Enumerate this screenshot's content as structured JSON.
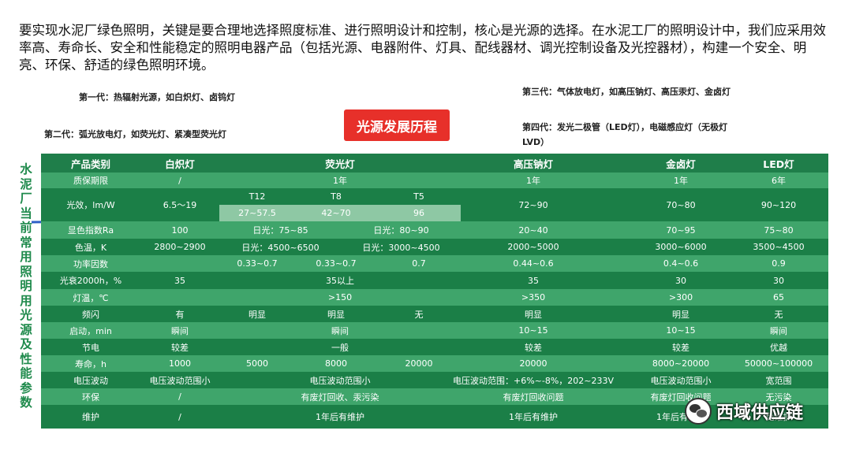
{
  "intro": "要实现水泥厂绿色照明，关键是要合理地选择照度标准、进行照明设计和控制，核心是光源的选择。在水泥工厂的照明设计中，我们应采用效率高、寿命长、安全和性能稳定的照明电器产品（包括光源、电器附件、灯具、配线器材、调光控制设备及光控器材），构建一个安全、明亮、环保、舒适的绿色照明环境。",
  "mindmap": {
    "center": "光源发展历程",
    "gen1": "第一代：热辐射光源，如白炽灯、卤钨灯",
    "gen2": "第二代：弧光放电灯，如荧光灯、紧凑型荧光灯",
    "gen3": "第三代：气体放电灯，如高压钠灯、高压汞灯、金卤灯",
    "gen4_line1": "第四代：发光二极管（LED灯），电磁感应灯（无极灯",
    "gen4_line2": "LVD）"
  },
  "side_title": [
    "水",
    "泥",
    "厂",
    "当",
    "前",
    "常",
    "用",
    "照",
    "明",
    "用",
    "光",
    "源",
    "及",
    "性",
    "能",
    "参",
    "数"
  ],
  "table": {
    "headers": [
      "产品类别",
      "白炽灯",
      "荧光灯",
      "高压钠灯",
      "金卤灯",
      "LED灯"
    ],
    "warranty": [
      "质保期限",
      "/",
      "1年",
      "1年",
      "1年",
      "6年"
    ],
    "efficacy_label": "光效，lm/W",
    "efficacy_incandescent": "6.5～19",
    "efficacy_fluor_types": [
      "T12",
      "T8",
      "T5"
    ],
    "efficacy_fluor_values": [
      "27~57.5",
      "42~70",
      "96"
    ],
    "efficacy_rest": [
      "72~90",
      "70~80",
      "90~120"
    ],
    "cri": [
      "显色指数Ra",
      "100",
      "日光：75~85",
      "日光：80~90",
      "20~40",
      "70~95",
      "75~80"
    ],
    "cct": [
      "色温，K",
      "2800~2900",
      "日光：4500~6500",
      "日光：3000~4500",
      "2000~5000",
      "3000~6000",
      "3500~4500"
    ],
    "pf": [
      "功率因数",
      "",
      "0.33~0.7",
      "0.33~0.7",
      "0.7",
      "0.44~0.6",
      "0.4~0.6",
      "0.9"
    ],
    "decay": [
      "光衰2000h，%",
      "35",
      "35以上",
      "35",
      "30",
      "30"
    ],
    "temp": [
      "灯温，℃",
      "",
      ">150",
      ">350",
      ">300",
      "65"
    ],
    "flicker": [
      "频闪",
      "有",
      "明显",
      "明显",
      "无",
      "明显",
      "明显",
      "无"
    ],
    "start": [
      "启动，min",
      "瞬间",
      "瞬间",
      "10~15",
      "10~15",
      "瞬间"
    ],
    "saving": [
      "节电",
      "较差",
      "一般",
      "较差",
      "较差",
      "优越"
    ],
    "life": [
      "寿命，h",
      "1000",
      "5000",
      "8000",
      "20000",
      "20000",
      "8000~20000",
      "50000~100000"
    ],
    "voltage": [
      "电压波动",
      "电压波动范围小",
      "电压波动范围小",
      "电压波动范围：+6%~-8%，202~233V",
      "电压波动范围小",
      "宽范围"
    ],
    "env": [
      "环保",
      "/",
      "有废灯回收、汞污染",
      "有废灯回收问题",
      "有废灯回收问题",
      "无污染"
    ],
    "maint": [
      "维护",
      "/",
      "1年后有维护",
      "1年后有维护",
      "1年后有维护",
      "免维护"
    ]
  },
  "watermark": "西域供应链",
  "colors": {
    "dark_row": "#1b7f47",
    "light_row": "#3fa56b",
    "center_box": "#e7302a",
    "side_text": "#1f8a4c"
  }
}
